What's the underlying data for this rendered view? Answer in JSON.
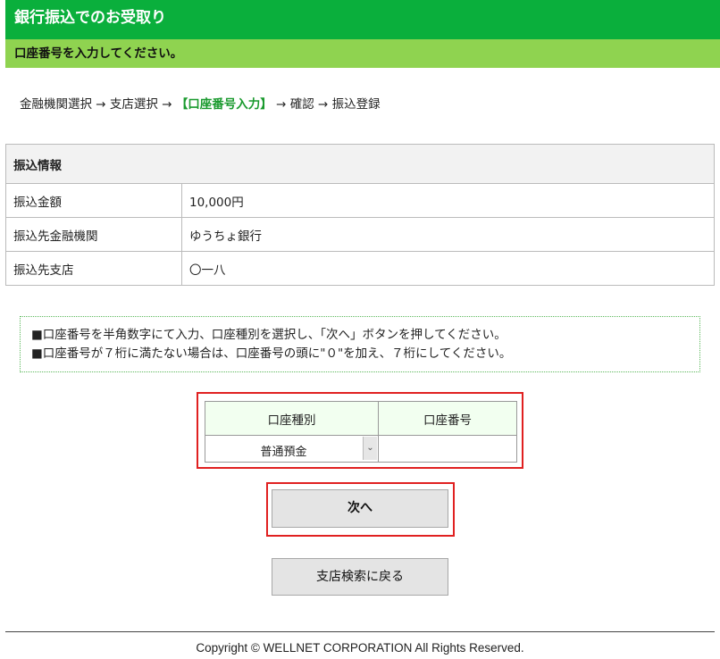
{
  "header": {
    "title": "銀行振込でのお受取り"
  },
  "subheader": {
    "instruction": "口座番号を入力してください。"
  },
  "steps": {
    "step1": "金融機関選択",
    "step2": "支店選択",
    "step3": "【口座番号入力】",
    "step4": "確認",
    "step5": "振込登録",
    "arrow": "→"
  },
  "transfer_info": {
    "title": "振込情報",
    "rows": [
      {
        "label": "振込金額",
        "value": "10,000円"
      },
      {
        "label": "振込先金融機関",
        "value": "ゆうちょ銀行"
      },
      {
        "label": "振込先支店",
        "value": "〇一八"
      }
    ]
  },
  "notice": {
    "lines": [
      "■口座番号を半角数字にて入力、口座種別を選択し、「次へ」ボタンを押してください。",
      "■口座番号が７桁に満たない場合は、口座番号の頭に\"０\"を加え、７桁にしてください。"
    ]
  },
  "form": {
    "account_type_header": "口座種別",
    "account_number_header": "口座番号",
    "account_type_selected": "普通預金",
    "account_number_value": ""
  },
  "buttons": {
    "next": "次へ",
    "back": "支店検索に戻る"
  },
  "footer": {
    "copyright": "Copyright © WELLNET CORPORATION All Rights Reserved."
  },
  "colors": {
    "header_green": "#0aaf3c",
    "subheader_green": "#8fd350",
    "highlight_red": "#e02020",
    "step_current": "#1a9a2e"
  }
}
